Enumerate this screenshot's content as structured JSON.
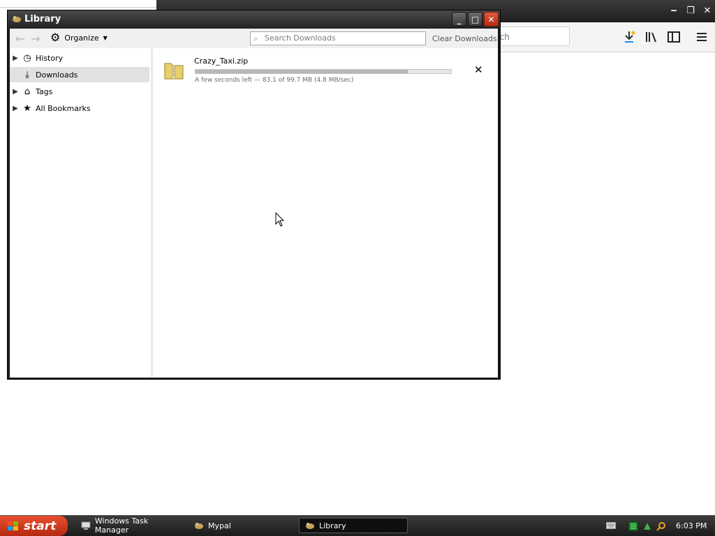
{
  "library": {
    "title": "Library",
    "toolbar": {
      "organize_label": "Organize",
      "search_placeholder": "Search Downloads",
      "clear_label": "Clear Downloads"
    },
    "sidebar": {
      "items": [
        {
          "label": "History",
          "icon": "clock-icon"
        },
        {
          "label": "Downloads",
          "icon": "download-icon"
        },
        {
          "label": "Tags",
          "icon": "tag-icon"
        },
        {
          "label": "All Bookmarks",
          "icon": "star-icon"
        }
      ],
      "selected": "Downloads"
    },
    "download": {
      "filename": "Crazy_Taxi.zip",
      "progress": 0.83,
      "status": "A few seconds left — 83.1 of 99.7 MB (4.8 MB/sec)"
    }
  },
  "background_browser": {
    "search_text": "rch"
  },
  "taskbar": {
    "start_label": "start",
    "tasks": [
      {
        "label": "Windows Task Manager"
      },
      {
        "label": "Mypal"
      },
      {
        "label": "Library"
      }
    ],
    "clock": "6:03 PM"
  },
  "colors": {
    "titlebar": "#2b2b2b",
    "close_button": "#c83a1c",
    "selected_row": "#e1e1e1",
    "start_button": "#c8381a"
  }
}
